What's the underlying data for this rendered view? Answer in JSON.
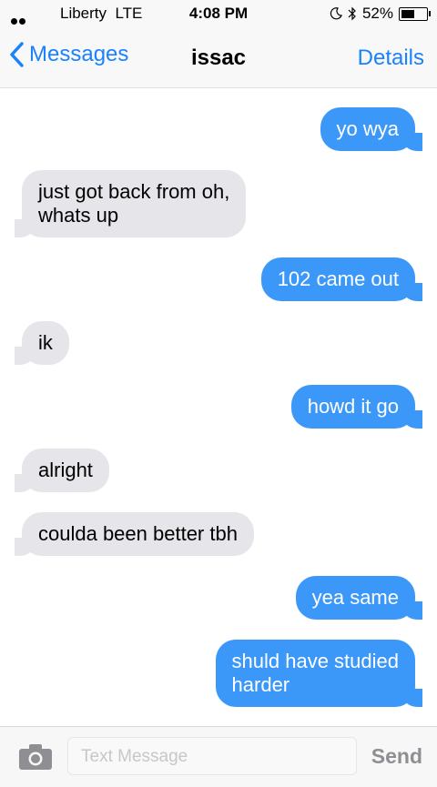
{
  "status": {
    "carrier": "Liberty",
    "network": "LTE",
    "time": "4:08 PM",
    "battery": "52%",
    "battery_level": 0.52
  },
  "nav": {
    "back_label": "Messages",
    "title": "issac",
    "details_label": "Details"
  },
  "messages": [
    {
      "direction": "sent",
      "lines": [
        "yo wya"
      ]
    },
    {
      "direction": "received",
      "lines": [
        "just got back from oh,",
        "whats up"
      ]
    },
    {
      "direction": "sent",
      "lines": [
        "102 came out"
      ]
    },
    {
      "direction": "received",
      "lines": [
        "ik"
      ]
    },
    {
      "direction": "sent",
      "lines": [
        "howd it go"
      ]
    },
    {
      "direction": "received",
      "lines": [
        "alright"
      ]
    },
    {
      "direction": "received",
      "lines": [
        "coulda been better tbh"
      ]
    },
    {
      "direction": "sent",
      "lines": [
        "yea same"
      ]
    },
    {
      "direction": "sent",
      "lines": [
        "shuld have studied",
        "harder"
      ]
    }
  ],
  "compose": {
    "placeholder": "Text Message",
    "send_label": "Send",
    "camera_icon": "camera-icon"
  },
  "colors": {
    "accent": "#1a82fb",
    "sent_bubble": "#3c98f8",
    "received_bubble": "#e5e5ea"
  }
}
